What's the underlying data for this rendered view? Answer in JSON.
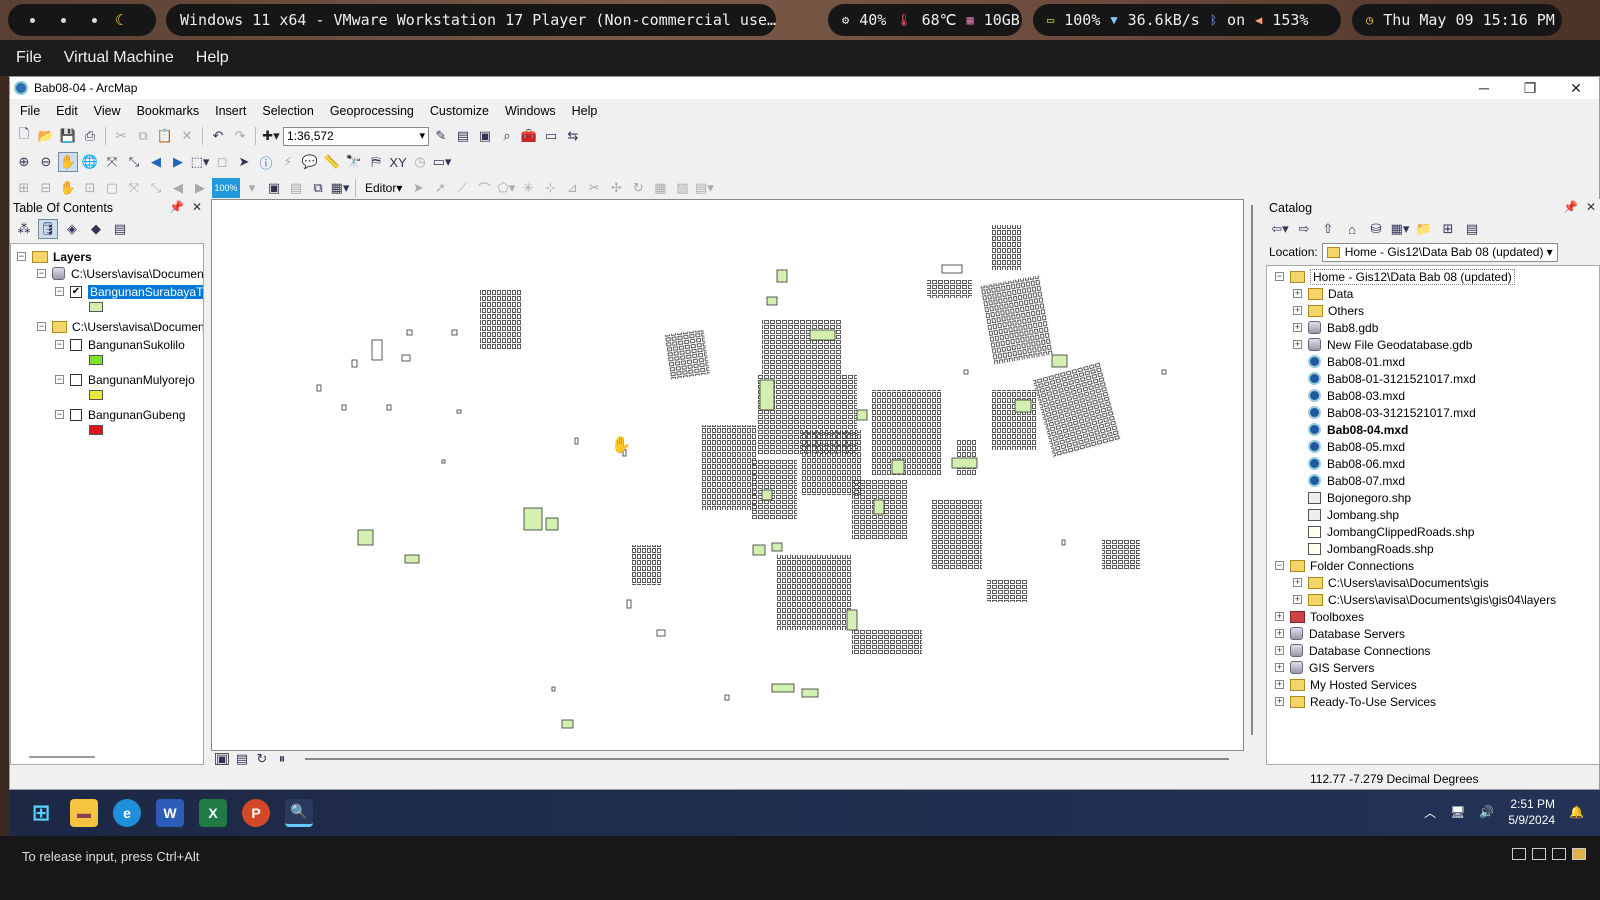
{
  "host": {
    "window_title": "Windows 11 x64 - VMware Workstation 17 Player (Non-commercial use…",
    "cpu": "40%",
    "temp": "68℃",
    "memory": "10GB",
    "battery": "100%",
    "net": "36.6kB/s",
    "bluetooth": "on",
    "volume": "153%",
    "datetime": "Thu May 09 15:16 PM"
  },
  "vm_menu": [
    "File",
    "Virtual Machine",
    "Help"
  ],
  "arcmap": {
    "title": "Bab08-04 - ArcMap",
    "menu": [
      "File",
      "Edit",
      "View",
      "Bookmarks",
      "Insert",
      "Selection",
      "Geoprocessing",
      "Customize",
      "Windows",
      "Help"
    ],
    "scale": "1:36,572",
    "editor_label": "Editor▾",
    "zoom_value": "100%"
  },
  "toc": {
    "title": "Table Of Contents",
    "root": "Layers",
    "groups": [
      {
        "path": "C:\\Users\\avisa\\Documen",
        "layers": [
          {
            "name": "BangunanSurabayaTi",
            "checked": true,
            "color": "#d3f0b0"
          }
        ]
      },
      {
        "path": "C:\\Users\\avisa\\Documen",
        "layers": [
          {
            "name": "BangunanSukolilo",
            "checked": false,
            "color": "#7de02a"
          },
          {
            "name": "BangunanMulyorejo",
            "checked": false,
            "color": "#e8e83c"
          },
          {
            "name": "BangunanGubeng",
            "checked": false,
            "color": "#e0121a"
          }
        ]
      }
    ]
  },
  "catalog": {
    "title": "Catalog",
    "location_label": "Location:",
    "location_value": "Home - Gis12\\Data Bab 08 (updated)",
    "home": "Home - Gis12\\Data Bab 08 (updated)",
    "items": [
      "Data",
      "Others",
      "Bab8.gdb",
      "New File Geodatabase.gdb",
      "Bab08-01.mxd",
      "Bab08-01-3121521017.mxd",
      "Bab08-03.mxd",
      "Bab08-03-3121521017.mxd",
      "Bab08-04.mxd",
      "Bab08-05.mxd",
      "Bab08-06.mxd",
      "Bab08-07.mxd",
      "Bojonegoro.shp",
      "Jombang.shp",
      "JombangClippedRoads.shp",
      "JombangRoads.shp"
    ],
    "folder_connections": "Folder Connections",
    "connections": [
      "C:\\Users\\avisa\\Documents\\gis",
      "C:\\Users\\avisa\\Documents\\gis\\gis04\\layers"
    ],
    "roots": [
      "Toolboxes",
      "Database Servers",
      "Database Connections",
      "GIS Servers",
      "My Hosted Services",
      "Ready-To-Use Services"
    ]
  },
  "status": {
    "coords": "112.77  -7.279 Decimal Degrees"
  },
  "taskbar": {
    "time": "2:51 PM",
    "date": "5/9/2024"
  },
  "vm_footer": "To release input, press Ctrl+Alt"
}
